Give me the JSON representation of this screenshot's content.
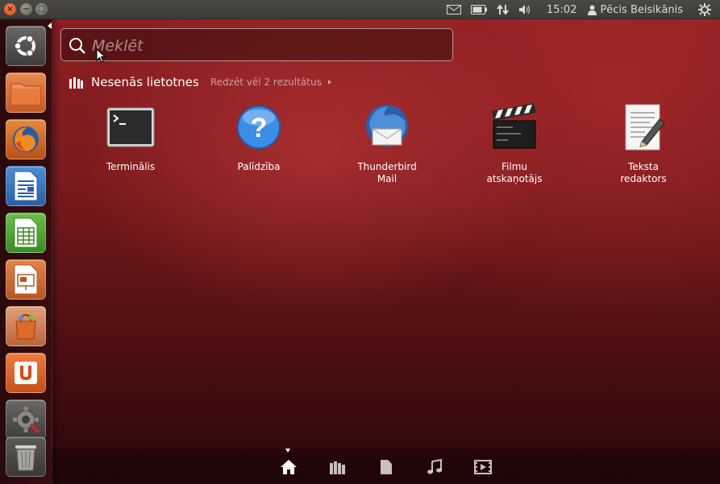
{
  "window_controls": {
    "close": "×",
    "minimize": "−",
    "maximize": "□"
  },
  "panel": {
    "clock": "15:02",
    "user": "Pēcis Beisikānis",
    "indicators": [
      "mail-icon",
      "battery-icon",
      "network-icon",
      "volume-icon",
      "user-icon",
      "session-gear-icon"
    ]
  },
  "launcher": {
    "items": [
      {
        "name": "dash-home",
        "icon": "ubuntu-logo-icon"
      },
      {
        "name": "files",
        "icon": "folder-icon"
      },
      {
        "name": "firefox",
        "icon": "firefox-icon"
      },
      {
        "name": "writer",
        "icon": "libreoffice-writer-icon"
      },
      {
        "name": "calc",
        "icon": "libreoffice-calc-icon"
      },
      {
        "name": "impress",
        "icon": "libreoffice-impress-icon"
      },
      {
        "name": "software-center",
        "icon": "software-center-icon"
      },
      {
        "name": "ubuntu-one",
        "icon": "ubuntu-one-icon"
      },
      {
        "name": "system-settings",
        "icon": "settings-icon"
      },
      {
        "name": "trash",
        "icon": "trash-icon"
      }
    ]
  },
  "search": {
    "placeholder": "Meklēt"
  },
  "section": {
    "title": "Nesenās lietotnes",
    "more": "Redzēt vēl 2 rezultātus"
  },
  "apps": [
    {
      "line1": "Terminālis",
      "line2": "",
      "icon": "terminal-icon"
    },
    {
      "line1": "Palīdzība",
      "line2": "",
      "icon": "help-icon"
    },
    {
      "line1": "Thunderbird",
      "line2": "Mail",
      "icon": "thunderbird-icon"
    },
    {
      "line1": "Filmu",
      "line2": "atskaņotājs",
      "icon": "movie-player-icon"
    },
    {
      "line1": "Teksta",
      "line2": "redaktors",
      "icon": "text-editor-icon"
    }
  ],
  "lenses": [
    "home-lens-icon",
    "applications-lens-icon",
    "files-lens-icon",
    "music-lens-icon",
    "video-lens-icon"
  ],
  "colors": {
    "accent": "#dd4814",
    "dash_bg": "#7a1a1d"
  }
}
